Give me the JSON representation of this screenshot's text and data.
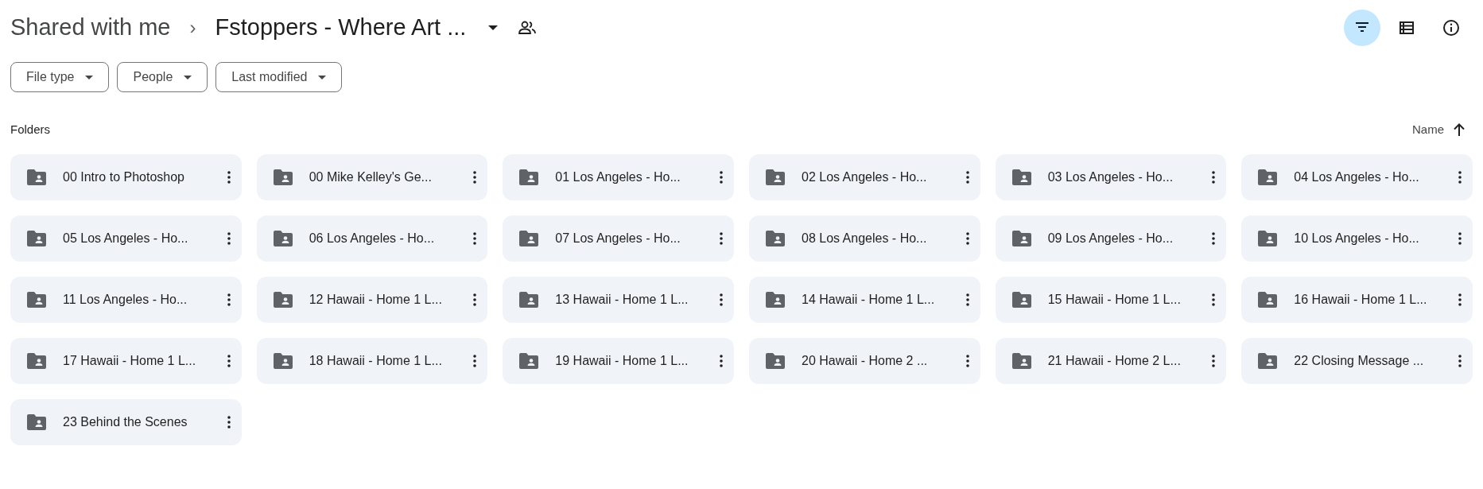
{
  "breadcrumb": {
    "parent": "Shared with me",
    "separator": "›",
    "current": "Fstoppers - Where Art ..."
  },
  "toolbar": [
    {
      "kind": "filter",
      "selected": true
    },
    {
      "kind": "list",
      "selected": false
    },
    {
      "kind": "info",
      "selected": false
    }
  ],
  "filters": [
    {
      "label": "File type"
    },
    {
      "label": "People"
    },
    {
      "label": "Last modified"
    }
  ],
  "section": {
    "title": "Folders",
    "sort_label": "Name"
  },
  "folders": [
    {
      "name": "00 Intro to Photoshop"
    },
    {
      "name": "00 Mike Kelley's Ge..."
    },
    {
      "name": "01 Los Angeles - Ho..."
    },
    {
      "name": "02 Los Angeles - Ho..."
    },
    {
      "name": "03 Los Angeles - Ho..."
    },
    {
      "name": "04 Los Angeles - Ho..."
    },
    {
      "name": "05 Los Angeles - Ho..."
    },
    {
      "name": "06 Los Angeles - Ho..."
    },
    {
      "name": "07 Los Angeles - Ho..."
    },
    {
      "name": "08 Los Angeles - Ho..."
    },
    {
      "name": "09 Los Angeles - Ho..."
    },
    {
      "name": "10 Los Angeles - Ho..."
    },
    {
      "name": "11 Los Angeles - Ho..."
    },
    {
      "name": "12 Hawaii - Home 1 L..."
    },
    {
      "name": "13 Hawaii - Home 1 L..."
    },
    {
      "name": "14 Hawaii - Home 1 L..."
    },
    {
      "name": "15 Hawaii - Home 1 L..."
    },
    {
      "name": "16 Hawaii - Home 1 L..."
    },
    {
      "name": "17 Hawaii - Home 1 L..."
    },
    {
      "name": "18 Hawaii - Home 1 L..."
    },
    {
      "name": "19 Hawaii - Home 1 L..."
    },
    {
      "name": "20 Hawaii - Home 2 ..."
    },
    {
      "name": "21 Hawaii - Home 2 L..."
    },
    {
      "name": "22 Closing Message ..."
    },
    {
      "name": "23 Behind the Scenes"
    }
  ]
}
